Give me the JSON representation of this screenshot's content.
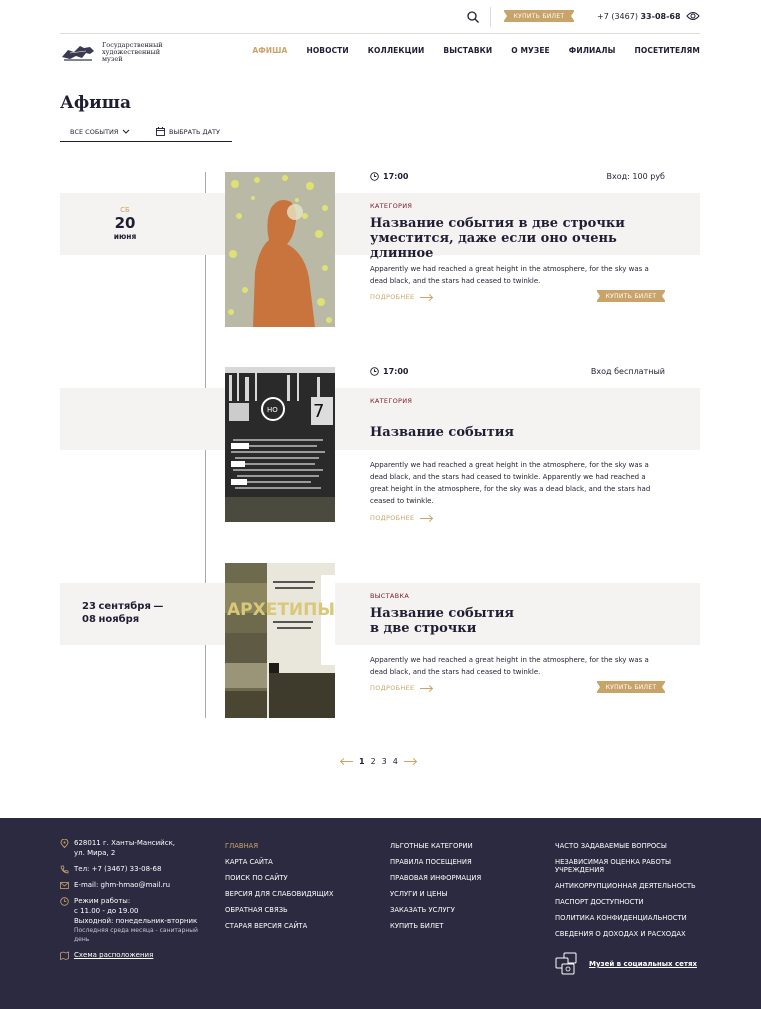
{
  "topbar": {
    "buy_ticket": "Купить билет",
    "phone_prefix": "+7 (3467)",
    "phone_number": "33-08-68"
  },
  "logo": {
    "text": "Государственный художественный музей"
  },
  "nav": [
    {
      "label": "Афиша",
      "active": true
    },
    {
      "label": "Новости"
    },
    {
      "label": "Коллекции"
    },
    {
      "label": "Выставки"
    },
    {
      "label": "О музее"
    },
    {
      "label": "Филиалы"
    },
    {
      "label": "Посетителям"
    }
  ],
  "page": {
    "title": "Афиша",
    "filter_events": "Все события",
    "filter_date": "Выбрать дату"
  },
  "events": [
    {
      "date_dow": "СБ",
      "date_day": "20",
      "date_month": "июня",
      "time": "17:00",
      "entry": "Вход: 100 руб",
      "category": "Категория",
      "title": "Название события в две строчки уместится, даже если оно очень длинное",
      "description": "Apparently we had reached a great height in the atmosphere, for the sky was a dead black, and the stars had ceased to twinkle.",
      "more": "Подробнее",
      "buy": "Купить билет"
    },
    {
      "time": "17:00",
      "entry": "Вход бесплатный",
      "category": "Категория",
      "title": "Название события",
      "description": "Apparently we had reached a great height in the atmosphere, for the sky was a dead black, and the stars had ceased to twinkle. Apparently we had reached a great height in the atmosphere, for the sky was a dead black, and the stars had ceased to twinkle.",
      "more": "Подробнее"
    },
    {
      "range_start_day": "23",
      "range_start_month": "сентября",
      "range_dash": "—",
      "range_end_day": "08",
      "range_end_month": "ноября",
      "category": "Выставка",
      "title": "Название события в две строчки",
      "description": "Apparently we had reached a great height in the atmosphere, for the sky was a dead black, and the stars had ceased to twinkle.",
      "more": "Подробнее",
      "buy": "Купить билет"
    }
  ],
  "poster_text": "АРХЕТИПЫ",
  "pagination": {
    "pages": [
      "1",
      "2",
      "3",
      "4"
    ],
    "current": "1"
  },
  "footer": {
    "address_line1": "628011 г. Ханты-Мансийск,",
    "address_line2": "ул. Мира, 2",
    "phone": "Тел: +7 (3467) 33-08-68",
    "email": "E-mail: ghm-hmao@mail.ru",
    "hours_title": "Режим работы:",
    "hours_line1": "с 11.00 - до 19.00",
    "hours_line2": "Выходной: понедельник-вторник",
    "hours_note": "Последняя среда месяца - санитарный день",
    "map_link": "Схема расположения",
    "col1": [
      "Главная",
      "Карта сайта",
      "Поиск по сайту",
      "Версия для слабовидящих",
      "Обратная связь",
      "Старая версия сайта"
    ],
    "col2": [
      "Льготные категории",
      "Правила посещения",
      "Правовая информация",
      "Услуги и цены",
      "Заказать услугу",
      "Купить билет"
    ],
    "col3": [
      "Часто задаваемые вопросы",
      "Независимая оценка работы учреждения",
      "Антикоррупционная деятельность",
      "Паспорт доступности",
      "Политика конфиденциальности",
      "Сведения о доходах и расходах"
    ],
    "social": "Музей в социальных сетях"
  }
}
